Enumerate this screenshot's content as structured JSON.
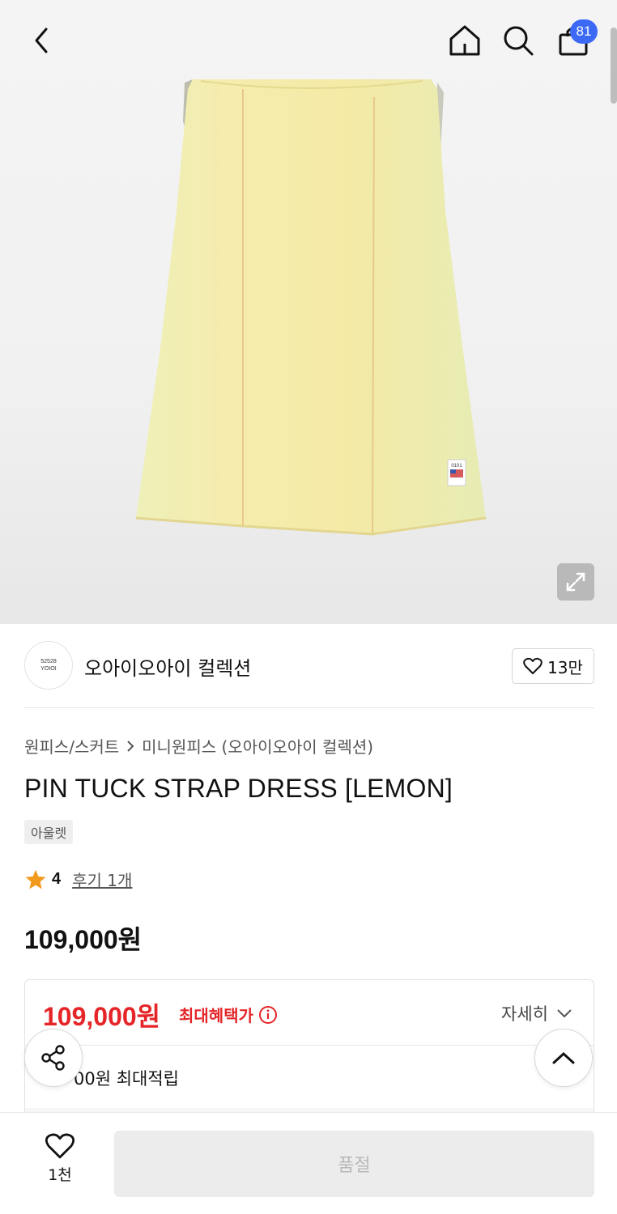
{
  "header": {
    "cart_count": "81"
  },
  "brand": {
    "logo_line1": "52528",
    "logo_line2": "YOIOI",
    "name": "오아이오아이 컬렉션",
    "follow_count": "13만"
  },
  "product": {
    "breadcrumb": [
      "원피스/스커트",
      "미니원피스 (오아이오아이 컬렉션)"
    ],
    "title": "PIN TUCK STRAP DRESS [LEMON]",
    "tag": "아울렛",
    "rating": "4",
    "reviews": "후기 1개",
    "price": "109,000원",
    "dress_label": "0101"
  },
  "benefit": {
    "price": "109,000원",
    "label": "최대혜택가",
    "detail": "자세히",
    "points": "00원 최대적립"
  },
  "bottom": {
    "wish_count": "1천",
    "soldout": "품절"
  },
  "colors": {
    "accent_red": "#e52528",
    "badge_blue": "#3d6af5",
    "dress_yellow": "#f3eaa5",
    "star": "#f29a1e"
  }
}
